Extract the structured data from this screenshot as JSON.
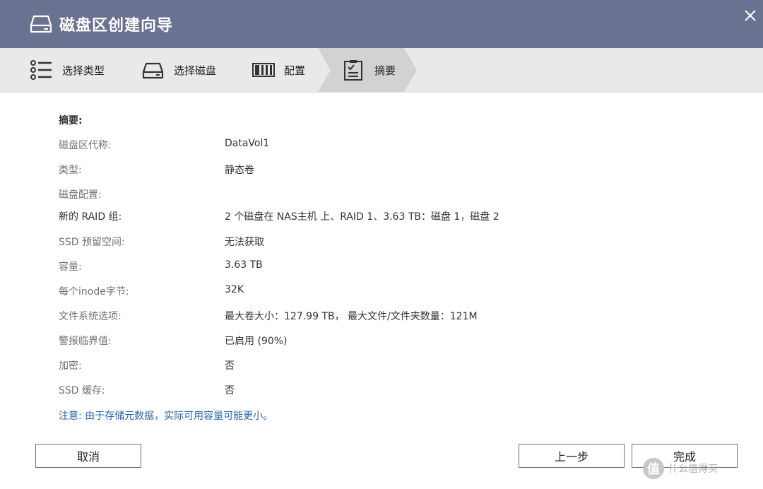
{
  "window": {
    "title": "磁盘区创建向导",
    "close_icon": "close-icon",
    "drive_icon": "drive-icon"
  },
  "steps": [
    {
      "label": "选择类型",
      "icon": "list-icon",
      "active": false
    },
    {
      "label": "选择磁盘",
      "icon": "disk-icon",
      "active": false
    },
    {
      "label": "配置",
      "icon": "config-icon",
      "active": false
    },
    {
      "label": "摘要",
      "icon": "clipboard-icon",
      "active": true
    }
  ],
  "summary": {
    "heading": "摘要:",
    "rows": [
      {
        "key": "磁盘区代称:",
        "value": "DataVol1"
      },
      {
        "key": "类型:",
        "value": "静态卷"
      },
      {
        "key": "磁盘配置:",
        "value": ""
      },
      {
        "key": "新的 RAID 组:",
        "value": "2 个磁盘在 NAS主机 上、RAID 1、3.63 TB：磁盘 1，磁盘 2"
      },
      {
        "key": "SSD 预留空间:",
        "value": "无法获取"
      },
      {
        "key": "容量:",
        "value": "3.63 TB"
      },
      {
        "key": "每个inode字节:",
        "value": "32K"
      },
      {
        "key": "文件系统选项:",
        "value": "最大卷大小：127.99 TB， 最大文件/文件夹数量：121M"
      },
      {
        "key": "警报临界值:",
        "value": "已启用 (90%)"
      },
      {
        "key": "加密:",
        "value": "否"
      },
      {
        "key": "SSD 缓存:",
        "value": "否"
      }
    ],
    "note": "注意: 由于存储元数据，实际可用容量可能更小。"
  },
  "buttons": {
    "cancel": "取消",
    "prev": "上一步",
    "finish": "完成"
  },
  "watermark": {
    "badge": "值",
    "text": "什么值得买"
  },
  "colors": {
    "titlebar": "#6b7291",
    "steps_bg": "#e9e9ea",
    "active_step": "#d2d2d4",
    "note": "#2a62a8"
  }
}
